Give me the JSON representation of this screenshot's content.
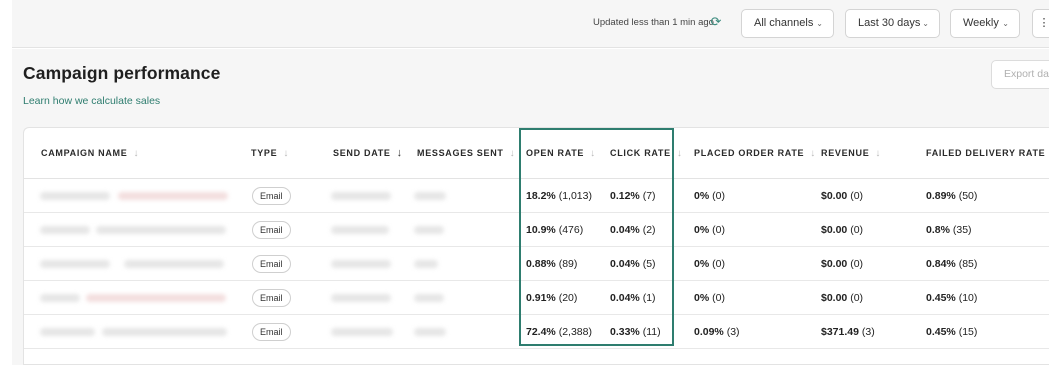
{
  "toolbar": {
    "updated_text": "Updated less than 1 min ago",
    "channel_filter": "All channels",
    "range_filter": "Last 30 days",
    "frequency_filter": "Weekly",
    "more_label": "⋮"
  },
  "header": {
    "title": "Campaign performance",
    "learn_link": "Learn how we calculate sales",
    "export_label": "Export dat"
  },
  "table": {
    "columns": [
      {
        "label": "CAMPAIGN NAME",
        "sort": "none"
      },
      {
        "label": "TYPE",
        "sort": "none"
      },
      {
        "label": "SEND DATE",
        "sort": "desc"
      },
      {
        "label": "MESSAGES SENT",
        "sort": "none"
      },
      {
        "label": "OPEN RATE",
        "sort": "none"
      },
      {
        "label": "CLICK RATE",
        "sort": "none"
      },
      {
        "label": "PLACED ORDER RATE",
        "sort": "none"
      },
      {
        "label": "REVENUE",
        "sort": "none"
      },
      {
        "label": "FAILED DELIVERY RATE",
        "sort": "none"
      }
    ],
    "rows": [
      {
        "type": "Email",
        "open_pct": "18.2%",
        "open_count": "(1,013)",
        "click_pct": "0.12%",
        "click_count": "(7)",
        "order_pct": "0%",
        "order_count": "(0)",
        "revenue": "$0.00",
        "revenue_count": "(0)",
        "failed_pct": "0.89%",
        "failed_count": "(50)"
      },
      {
        "type": "Email",
        "open_pct": "10.9%",
        "open_count": "(476)",
        "click_pct": "0.04%",
        "click_count": "(2)",
        "order_pct": "0%",
        "order_count": "(0)",
        "revenue": "$0.00",
        "revenue_count": "(0)",
        "failed_pct": "0.8%",
        "failed_count": "(35)"
      },
      {
        "type": "Email",
        "open_pct": "0.88%",
        "open_count": "(89)",
        "click_pct": "0.04%",
        "click_count": "(5)",
        "order_pct": "0%",
        "order_count": "(0)",
        "revenue": "$0.00",
        "revenue_count": "(0)",
        "failed_pct": "0.84%",
        "failed_count": "(85)"
      },
      {
        "type": "Email",
        "open_pct": "0.91%",
        "open_count": "(20)",
        "click_pct": "0.04%",
        "click_count": "(1)",
        "order_pct": "0%",
        "order_count": "(0)",
        "revenue": "$0.00",
        "revenue_count": "(0)",
        "failed_pct": "0.45%",
        "failed_count": "(10)"
      },
      {
        "type": "Email",
        "open_pct": "72.4%",
        "open_count": "(2,388)",
        "click_pct": "0.33%",
        "click_count": "(11)",
        "order_pct": "0.09%",
        "order_count": "(3)",
        "revenue": "$371.49",
        "revenue_count": "(3)",
        "failed_pct": "0.45%",
        "failed_count": "(15)"
      }
    ]
  },
  "colors": {
    "accent": "#2e7d6f",
    "background": "#f6f6f6"
  }
}
